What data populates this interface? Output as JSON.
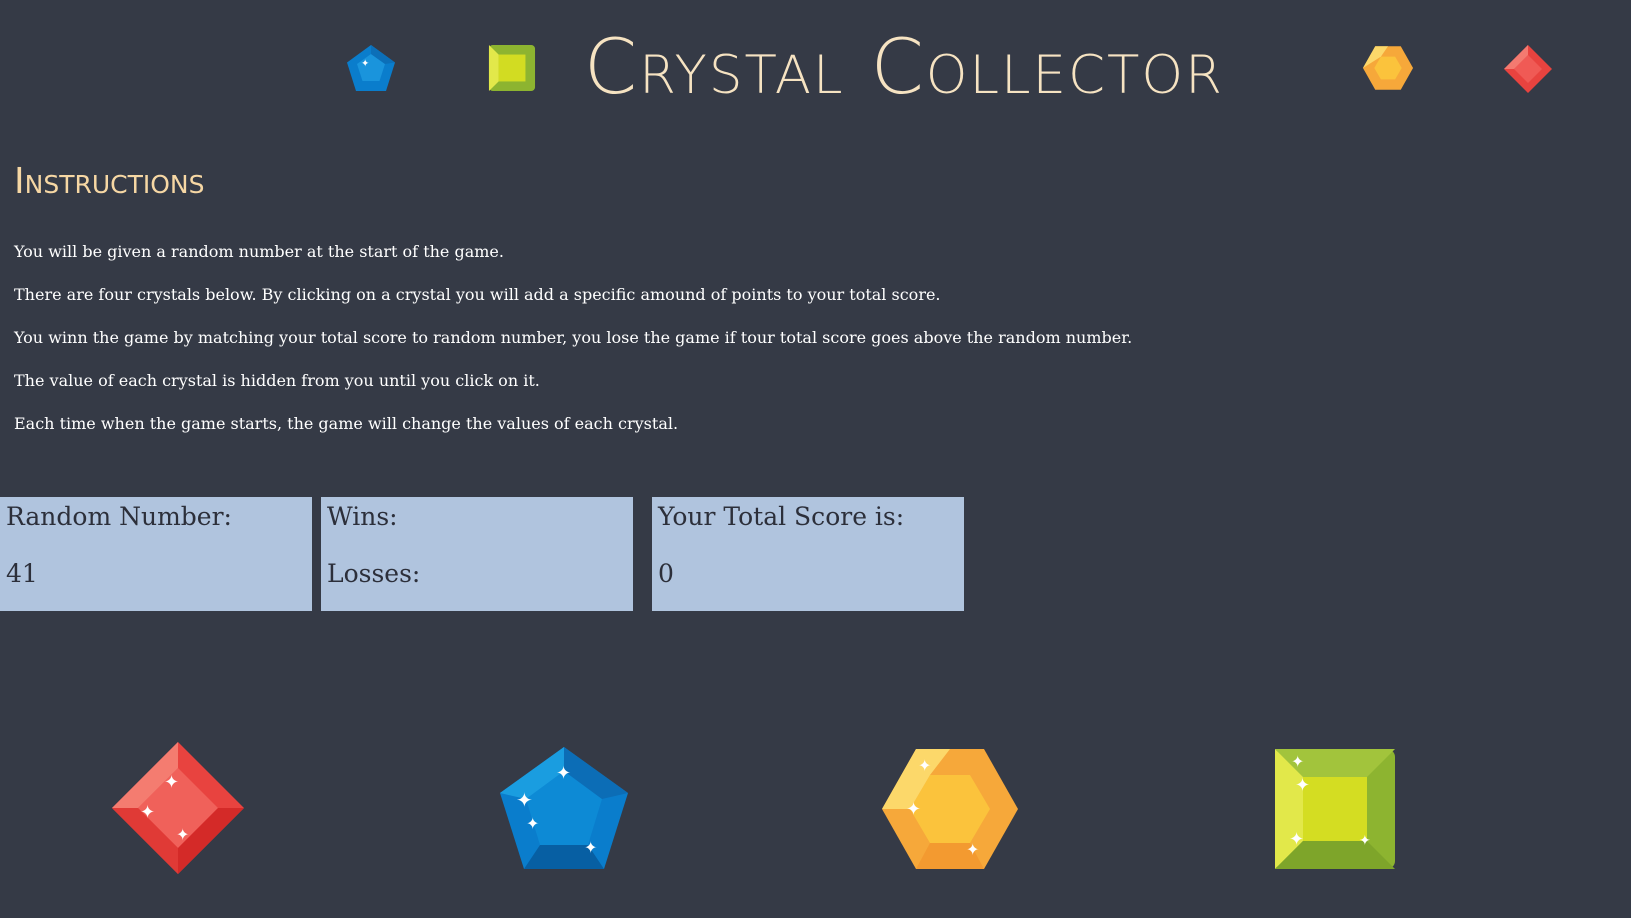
{
  "header": {
    "title": "Crystal Collector"
  },
  "instructions": {
    "heading": "Instructions",
    "lines": [
      "You will be given a random number at the start of the game.",
      "There are four crystals below. By clicking on a crystal you will add a specific amound of points to your total score.",
      "You winn the game by matching your total score to random number, you lose the game if tour total score goes above the random number.",
      "The value of each crystal is hidden from you until you click on it.",
      "Each time when the game starts, the game will change the values of each crystal."
    ]
  },
  "scoreboard": {
    "random_number_label": "Random Number:",
    "random_number_value": "41",
    "wins_label": "Wins:",
    "losses_label": "Losses:",
    "total_score_label": "Your Total Score is:",
    "total_score_value": "0"
  },
  "crystals": [
    {
      "name": "red-crystal",
      "color": "#e8433f"
    },
    {
      "name": "blue-crystal",
      "color": "#0a82d0"
    },
    {
      "name": "yellow-crystal",
      "color": "#f6b233"
    },
    {
      "name": "green-crystal",
      "color": "#a4c43a"
    }
  ],
  "colors": {
    "background": "#353a46",
    "title": "#f6e3c2",
    "heading": "#f6d7a4",
    "score_box": "#b0c4de"
  }
}
